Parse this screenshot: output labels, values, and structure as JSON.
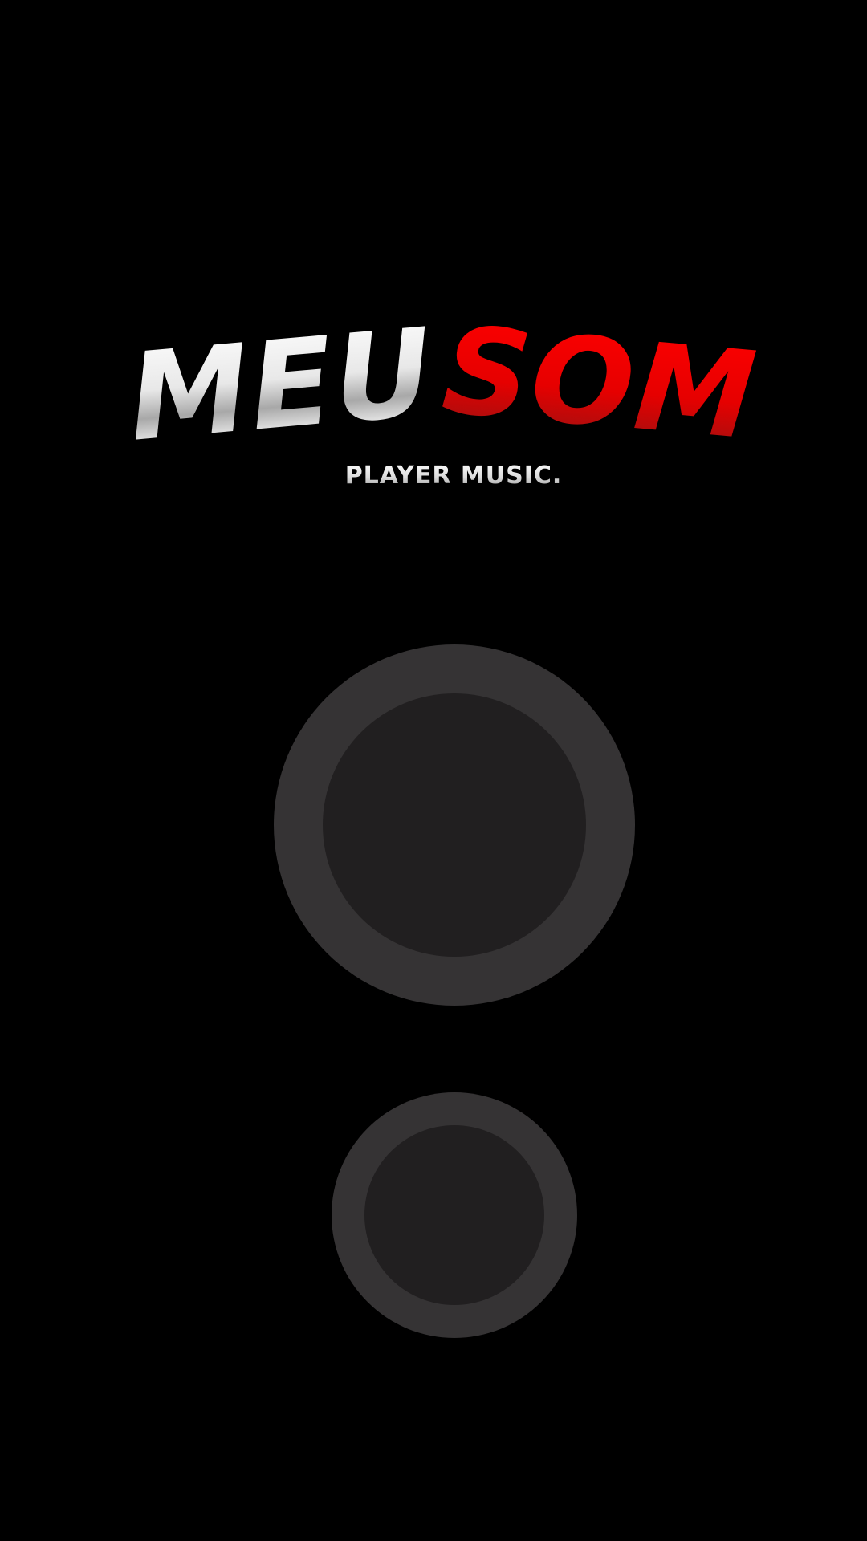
{
  "logo": {
    "part_light": "MEU",
    "part_red": "SOM",
    "tagline": "PLAYER MUSIC."
  },
  "colors": {
    "background": "#000000",
    "ring_outer": "#353334",
    "ring_inner": "#211f20",
    "accent_red": "#ff0000",
    "accent_red_dark": "#8f1414",
    "silver_light": "#ffffff",
    "silver_mid": "#a8a8a8"
  },
  "controls": {
    "primary_button_icon": "circle-ring-icon",
    "secondary_button_icon": "circle-ring-icon"
  }
}
